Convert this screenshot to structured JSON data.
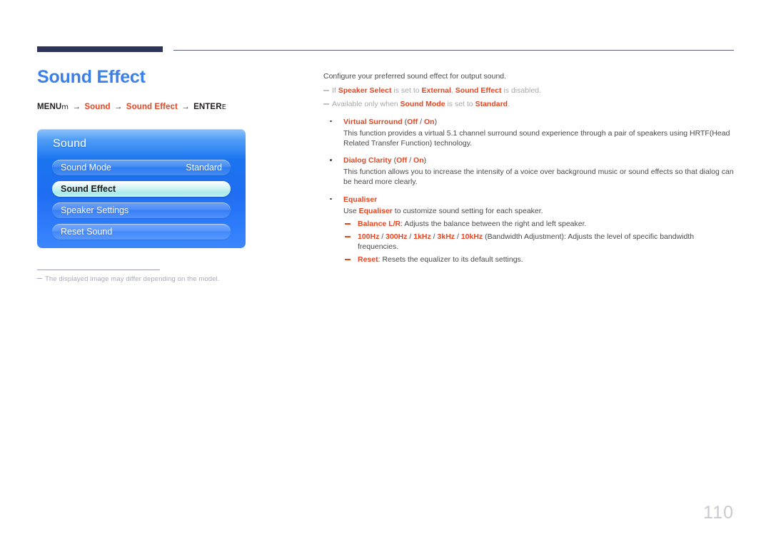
{
  "header": {
    "rule_color": "#2e3359"
  },
  "page": {
    "title": "Sound Effect",
    "number": "110",
    "title_color": "#3d7fe8",
    "accent_color": "#e8441f"
  },
  "menu_path": {
    "menu_label": "MENU",
    "menu_glyph": "m",
    "arrow": "→",
    "step1": "Sound",
    "step2": "Sound Effect",
    "enter_label": "ENTER",
    "enter_glyph": "E"
  },
  "osd": {
    "title": "Sound",
    "rows": [
      {
        "label": "Sound Mode",
        "value": "Standard",
        "selected": false
      },
      {
        "label": "Sound Effect",
        "value": "",
        "selected": true
      },
      {
        "label": "Speaker Settings",
        "value": "",
        "selected": false
      },
      {
        "label": "Reset Sound",
        "value": "",
        "selected": false
      }
    ]
  },
  "left_note": {
    "text": "The displayed image may differ depending on the model."
  },
  "content": {
    "lead": "Configure your preferred sound effect for output sound.",
    "notes": [
      {
        "parts": [
          {
            "t": "If ",
            "s": "note"
          },
          {
            "t": "Speaker Select",
            "s": "red"
          },
          {
            "t": " is set to ",
            "s": "note"
          },
          {
            "t": "External",
            "s": "red"
          },
          {
            "t": ", ",
            "s": "note"
          },
          {
            "t": "Sound Effect",
            "s": "red"
          },
          {
            "t": " is disabled.",
            "s": "note"
          }
        ]
      },
      {
        "parts": [
          {
            "t": "Available only when ",
            "s": "note"
          },
          {
            "t": "Sound Mode",
            "s": "red"
          },
          {
            "t": " is set to ",
            "s": "note"
          },
          {
            "t": "Standard",
            "s": "red"
          },
          {
            "t": ".",
            "s": "note"
          }
        ]
      }
    ],
    "bullets": [
      {
        "head_name": "Virtual Surround",
        "head_options": "(Off / On)",
        "body": "This function provides a virtual 5.1 channel surround sound experience through a pair of speakers using HRTF(Head Related Transfer Function) technology.",
        "subs": []
      },
      {
        "head_name": "Dialog Clarity",
        "head_options": "(Off / On)",
        "body": "This function allows you to increase the intensity of a voice over background music or sound effects so that dialog can be heard more clearly.",
        "subs": []
      },
      {
        "head_name": "Equaliser",
        "head_options": "",
        "body_parts": [
          {
            "t": "Use ",
            "s": "plain"
          },
          {
            "t": "Equaliser",
            "s": "red"
          },
          {
            "t": " to customize sound setting for each speaker.",
            "s": "plain"
          }
        ],
        "subs": [
          {
            "parts": [
              {
                "t": "Balance L/R",
                "s": "red"
              },
              {
                "t": ": Adjusts the balance between the right and left speaker.",
                "s": "plain"
              }
            ]
          },
          {
            "parts": [
              {
                "t": "100Hz",
                "s": "red"
              },
              {
                "t": " / ",
                "s": "plain"
              },
              {
                "t": "300Hz",
                "s": "red"
              },
              {
                "t": " / ",
                "s": "plain"
              },
              {
                "t": "1kHz",
                "s": "red"
              },
              {
                "t": " / ",
                "s": "plain"
              },
              {
                "t": "3kHz",
                "s": "red"
              },
              {
                "t": " / ",
                "s": "plain"
              },
              {
                "t": "10kHz",
                "s": "red"
              },
              {
                "t": " (Bandwidth Adjustment): Adjusts the level of specific bandwidth frequencies.",
                "s": "plain"
              }
            ]
          },
          {
            "parts": [
              {
                "t": "Reset",
                "s": "red"
              },
              {
                "t": ": Resets the equalizer to its default settings.",
                "s": "plain"
              }
            ]
          }
        ]
      }
    ]
  }
}
